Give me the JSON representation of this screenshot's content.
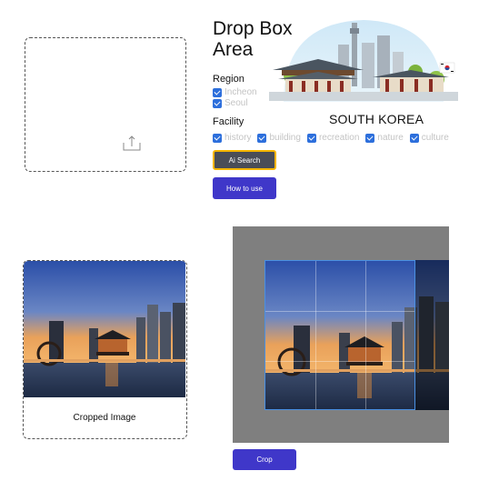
{
  "dropzone": {
    "icon": "upload-icon"
  },
  "title": "Drop Box Area",
  "hero": {
    "country_label": "SOUTH KOREA",
    "flag": "korea-flag-icon"
  },
  "region": {
    "label": "Region",
    "options": [
      {
        "label": "Incheon",
        "checked": true
      },
      {
        "label": "Seoul",
        "checked": true
      }
    ]
  },
  "facility": {
    "label": "Facility",
    "options": [
      {
        "label": "history",
        "checked": true
      },
      {
        "label": "building",
        "checked": true
      },
      {
        "label": "recreation",
        "checked": true
      },
      {
        "label": "nature",
        "checked": true
      },
      {
        "label": "culture",
        "checked": true
      }
    ]
  },
  "buttons": {
    "ai_search": "Ai Search",
    "how_to_use": "How to use",
    "crop": "Crop"
  },
  "cropped": {
    "caption": "Cropped Image"
  },
  "colors": {
    "primary": "#3f37c9",
    "focus_ring": "#f4b400",
    "checkbox": "#2d6fdc",
    "editor_bg": "#7f7f7f"
  }
}
